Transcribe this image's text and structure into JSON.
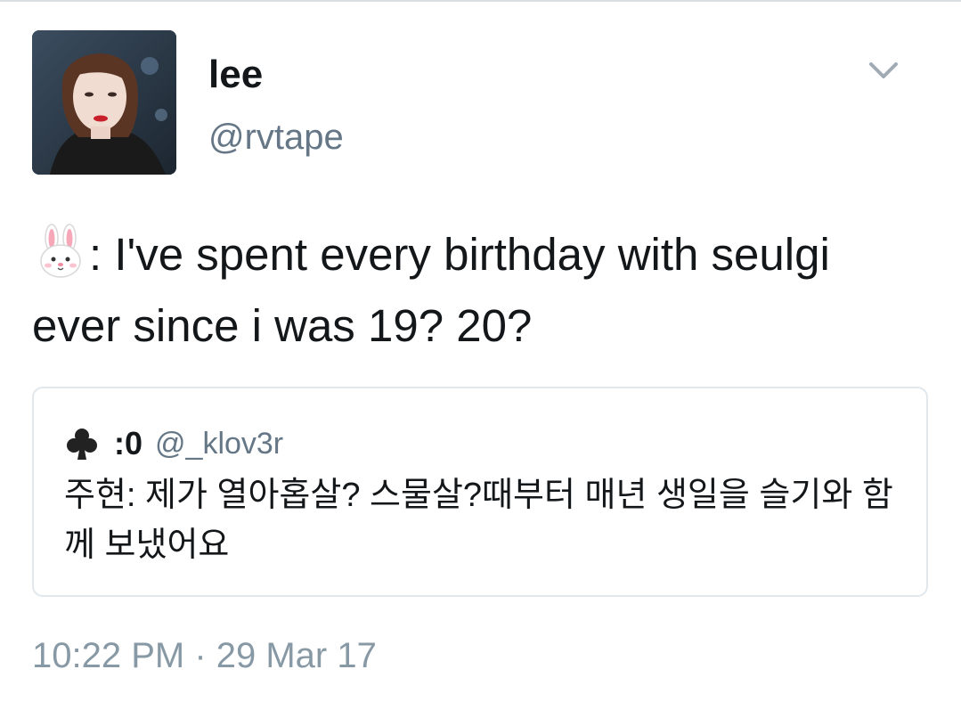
{
  "author": {
    "display_name": "lee",
    "handle": "@rvtape"
  },
  "tweet": {
    "emoji_icon": "rabbit-face-icon",
    "text": ": I've spent every birthday with seulgi ever since i was 19? 20?"
  },
  "quoted_tweet": {
    "icon": "club-suit-icon",
    "display_name": ":0",
    "handle": "@_klov3r",
    "text": "주현: 제가 열아홉살? 스물살?때부터 매년 생일을 슬기와 함께 보냈어요"
  },
  "timestamp": "10:22 PM · 29 Mar 17",
  "colors": {
    "text_primary": "#14171a",
    "text_secondary": "#657786",
    "timestamp": "#8899a6",
    "border": "#e1e8ed"
  }
}
